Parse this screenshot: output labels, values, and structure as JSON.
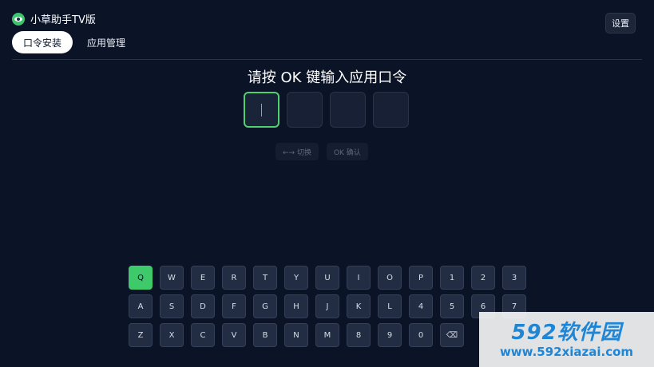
{
  "app": {
    "title": "小草助手TV版"
  },
  "header": {
    "settings_label": "设置"
  },
  "tabs": [
    {
      "label": "口令安装",
      "active": true
    },
    {
      "label": "应用管理",
      "active": false
    }
  ],
  "prompt": "请按 OK 键输入应用口令",
  "code": {
    "length": 4,
    "active_index": 0
  },
  "hints": {
    "switch": "←→ 切换",
    "confirm": "OK 确认"
  },
  "keyboard": {
    "rows": [
      [
        "Q",
        "W",
        "E",
        "R",
        "T",
        "Y",
        "U",
        "I",
        "O",
        "P",
        "1",
        "2",
        "3"
      ],
      [
        "A",
        "S",
        "D",
        "F",
        "G",
        "H",
        "J",
        "K",
        "L",
        "4",
        "5",
        "6",
        "7"
      ],
      [
        "Z",
        "X",
        "C",
        "V",
        "B",
        "N",
        "M",
        "8",
        "9",
        "0",
        "⌫"
      ]
    ],
    "active_key": "Q"
  },
  "watermark": {
    "brand": "592软件园",
    "url": "www.592xiazai.com",
    "color": "#1f86d6"
  },
  "colors": {
    "accent": "#3ec96b",
    "background": "#0b1326",
    "key": "#222c42"
  }
}
